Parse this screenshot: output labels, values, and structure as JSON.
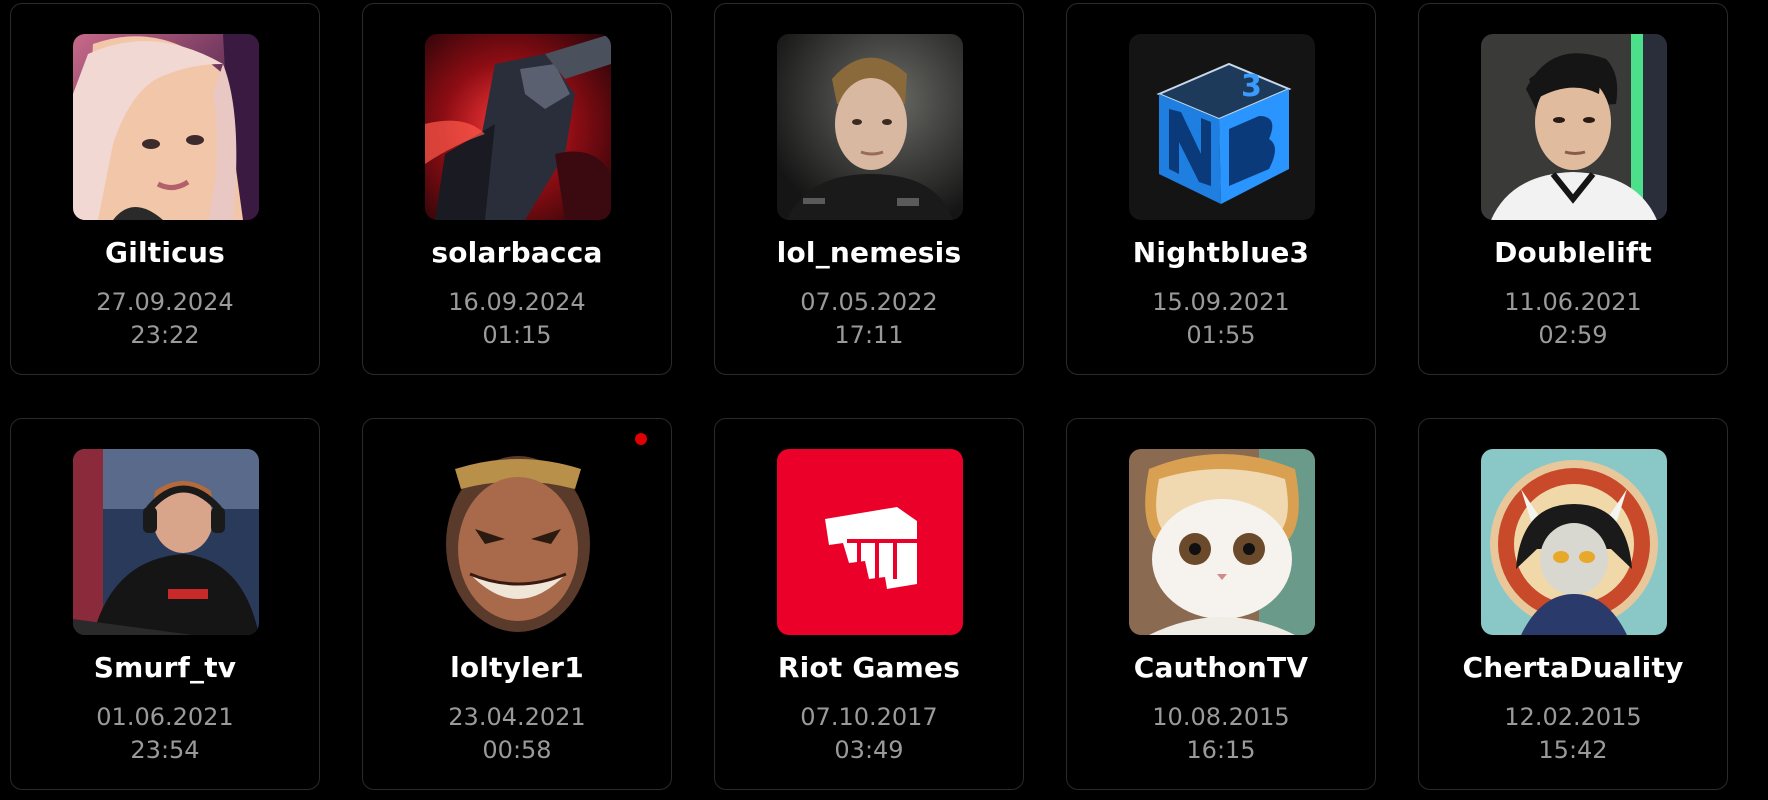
{
  "streamers": [
    {
      "name": "Gilticus",
      "date": "27.09.2024",
      "time": "23:22",
      "avatar_icon": "portrait-blonde-woman-icon"
    },
    {
      "name": "solarbacca",
      "date": "16.09.2024",
      "time": "01:15",
      "avatar_icon": "red-champion-art-icon"
    },
    {
      "name": "lol_nemesis",
      "date": "07.05.2022",
      "time": "17:11",
      "avatar_icon": "portrait-young-man-icon"
    },
    {
      "name": "Nightblue3",
      "date": "15.09.2021",
      "time": "01:55",
      "avatar_icon": "nb3-cube-logo-icon"
    },
    {
      "name": "Doublelift",
      "date": "11.06.2021",
      "time": "02:59",
      "avatar_icon": "portrait-man-icon"
    },
    {
      "name": "Smurf_tv",
      "date": "01.06.2021",
      "time": "23:54",
      "avatar_icon": "gamer-headset-icon"
    },
    {
      "name": "loltyler1",
      "date": "23.04.2021",
      "time": "00:58",
      "avatar_icon": "draven-face-icon",
      "live": true
    },
    {
      "name": "Riot Games",
      "date": "07.10.2017",
      "time": "03:49",
      "avatar_icon": "riot-fist-logo-icon"
    },
    {
      "name": "CauthonTV",
      "date": "10.08.2015",
      "time": "16:15",
      "avatar_icon": "bread-cat-icon"
    },
    {
      "name": "ChertaDuality",
      "date": "12.02.2015",
      "time": "15:42",
      "avatar_icon": "horned-character-icon"
    }
  ],
  "colors": {
    "background": "#000000",
    "card_border": "#2a2a2a",
    "name_text": "#ffffff",
    "meta_text": "#9a9a9a",
    "live_dot": "#e00000",
    "riot_red": "#eb0029"
  }
}
